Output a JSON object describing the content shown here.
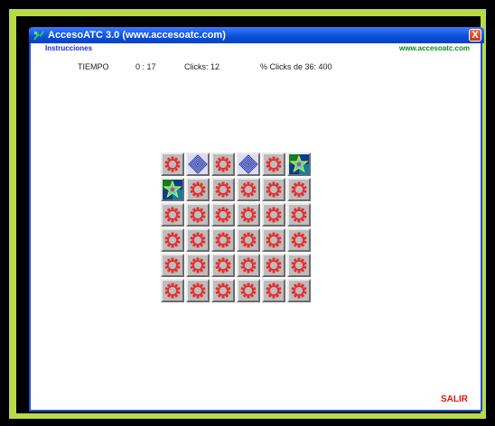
{
  "window": {
    "title": "AccesoATC 3.0 (www.accesoatc.com)",
    "close_label": "X"
  },
  "menu": {
    "instructions": "Instrucciones",
    "site": "www.accesoatc.com"
  },
  "status": {
    "time_label": "TIEMPO",
    "time_value": "0 : 17",
    "clicks": "Clicks: 12",
    "percent": "% Clicks de 36:  400"
  },
  "board": {
    "rows": [
      [
        "closed",
        "diamond",
        "closed",
        "diamond",
        "closed",
        "star"
      ],
      [
        "star",
        "closed",
        "closed",
        "closed",
        "closed",
        "closed"
      ],
      [
        "closed",
        "closed",
        "closed",
        "closed",
        "closed",
        "closed"
      ],
      [
        "closed",
        "closed",
        "closed",
        "closed",
        "closed",
        "closed"
      ],
      [
        "closed",
        "closed",
        "closed",
        "closed",
        "closed",
        "closed"
      ],
      [
        "closed",
        "closed",
        "closed",
        "closed",
        "closed",
        "closed"
      ]
    ]
  },
  "footer": {
    "exit_label": "SALIR"
  },
  "colors": {
    "frame": "#b9d84a",
    "titlebar": "#0a4fd8",
    "tile_ring": "#e53030",
    "diamond": "#2733a8",
    "exit": "#e31414"
  }
}
